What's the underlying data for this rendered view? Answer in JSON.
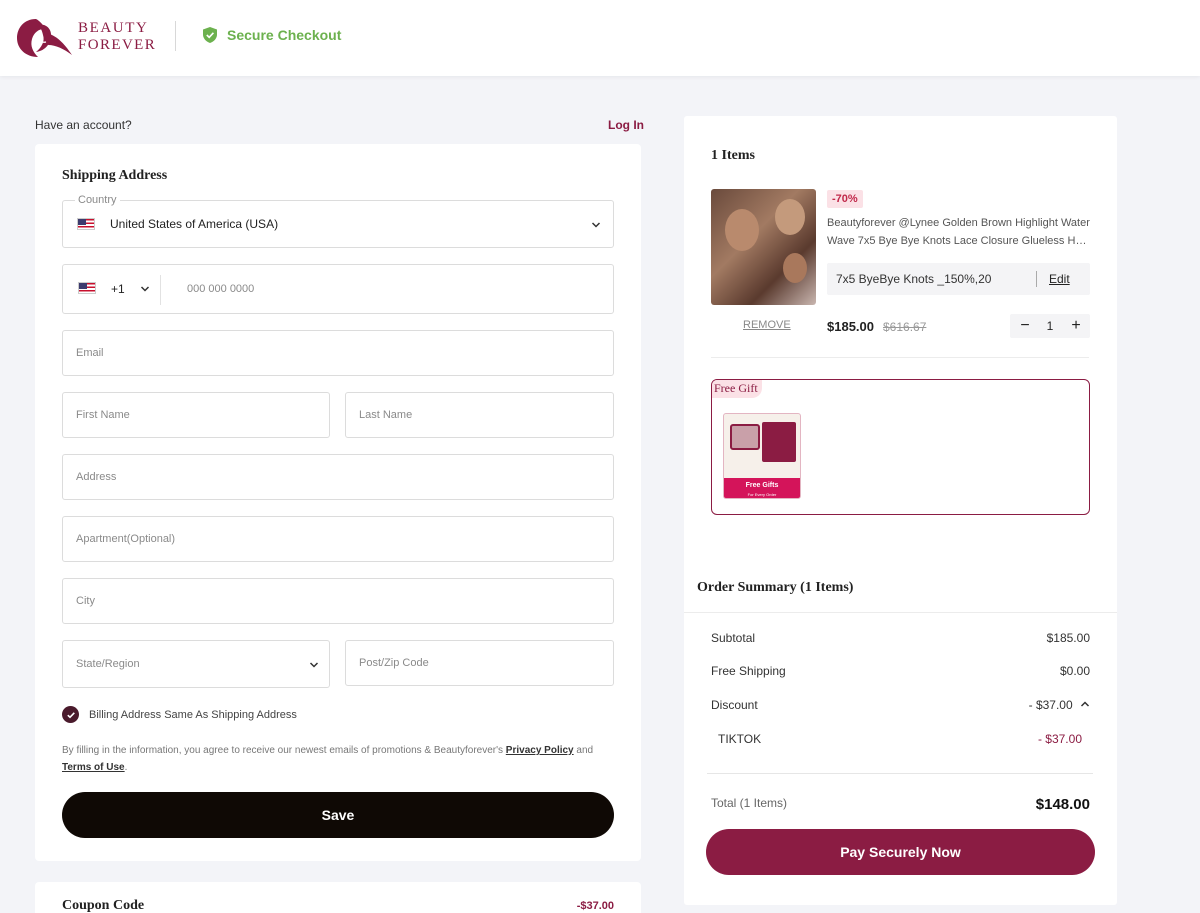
{
  "header": {
    "brand_line1": "BEAUTY",
    "brand_line2": "FOREVER",
    "secure_label": "Secure Checkout",
    "brand_color": "#8b1c43",
    "secure_color": "#6cb14e"
  },
  "account": {
    "prompt": "Have an account?",
    "login_label": "Log In"
  },
  "shipping": {
    "title": "Shipping Address",
    "country_legend": "Country",
    "country_value": "United States of America (USA)",
    "phone_code": "+1",
    "phone_placeholder": "000 000 0000",
    "email_placeholder": "Email",
    "first_name_placeholder": "First Name",
    "last_name_placeholder": "Last Name",
    "address_placeholder": "Address",
    "apartment_placeholder": "Apartment(Optional)",
    "city_placeholder": "City",
    "state_placeholder": "State/Region",
    "zip_placeholder": "Post/Zip Code",
    "billing_same_label": "Billing Address Same As Shipping Address",
    "billing_same_checked": true,
    "consent_text": "By filling in the information, you agree to receive our newest emails of promotions & Beautyforever's",
    "privacy_link": "Privacy Policy",
    "and_text": "and",
    "terms_link": "Terms of Use",
    "period": ".",
    "save_label": "Save"
  },
  "coupon": {
    "title": "Coupon Code",
    "value": "-$37.00"
  },
  "cart": {
    "items_title": "1 Items",
    "product": {
      "discount_badge": "-70%",
      "name_line1": "Beautyforever @Lynee Golden Brown Highlight Water",
      "name_line2": "Wave 7x5 Bye Bye Knots Lace Closure Glueless Hum...",
      "variant": "7x5 ByeBye Knots _150%,20",
      "edit_label": "Edit",
      "remove_label": "REMOVE",
      "price": "$185.00",
      "original_price": "$616.67",
      "qty_minus": "−",
      "quantity": "1",
      "qty_plus": "+"
    },
    "gift": {
      "tag": "Free Gift",
      "image_title": "Free Gifts",
      "image_subtitle": "For Every Order"
    }
  },
  "summary": {
    "title": "Order Summary (1 Items)",
    "subtotal_label": "Subtotal",
    "subtotal_value": "$185.00",
    "shipping_label": "Free Shipping",
    "shipping_value": "$0.00",
    "discount_label": "Discount",
    "discount_value": "- $37.00",
    "coupon_name": "TIKTOK",
    "coupon_value": "- $37.00",
    "total_label": "Total (1 Items)",
    "total_value": "$148.00",
    "pay_label": "Pay Securely Now"
  }
}
